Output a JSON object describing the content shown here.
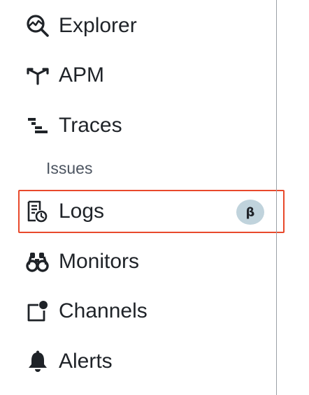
{
  "colors": {
    "highlight": "#e8492b",
    "badge_bg": "#c0d3dc",
    "text": "#1f2328",
    "subtext": "#4d5561",
    "divider": "#9aa0a6"
  },
  "sidebar": {
    "items": [
      {
        "label": "Explorer",
        "icon": "explorer-icon"
      },
      {
        "label": "APM",
        "icon": "apm-icon"
      },
      {
        "label": "Traces",
        "icon": "traces-icon"
      },
      {
        "label": "Issues",
        "icon": null
      },
      {
        "label": "Logs",
        "icon": "logs-icon",
        "badge": "β",
        "highlighted": true
      },
      {
        "label": "Monitors",
        "icon": "binoculars-icon"
      },
      {
        "label": "Channels",
        "icon": "channels-icon"
      },
      {
        "label": "Alerts",
        "icon": "bell-icon"
      }
    ]
  }
}
